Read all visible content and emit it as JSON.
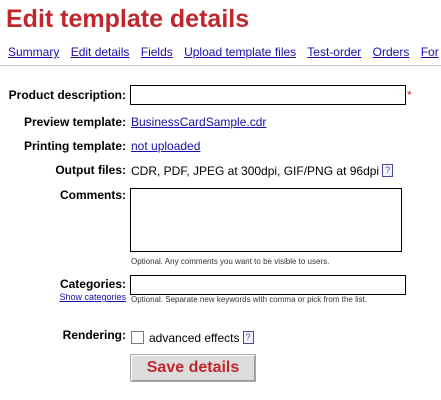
{
  "page": {
    "title": "Edit template details"
  },
  "nav": {
    "items": [
      {
        "label": "Summary"
      },
      {
        "label": "Edit details"
      },
      {
        "label": "Fields"
      },
      {
        "label": "Upload template files"
      },
      {
        "label": "Test-order"
      },
      {
        "label": "Orders"
      },
      {
        "label": "For"
      }
    ]
  },
  "form": {
    "product_description": {
      "label": "Product description:",
      "value": "",
      "required_mark": "*"
    },
    "preview_template": {
      "label": "Preview template:",
      "value": "BusinessCardSample.cdr"
    },
    "printing_template": {
      "label": "Printing template:",
      "value": "not uploaded"
    },
    "output_files": {
      "label": "Output files:",
      "value": "CDR, PDF, JPEG at 300dpi, GIF/PNG at 96dpi",
      "help": "?"
    },
    "comments": {
      "label": "Comments:",
      "value": "",
      "hint": "Optional. Any comments you want to be visible to users."
    },
    "categories": {
      "label": "Categories:",
      "value": "",
      "show_link": "Show categories",
      "hint": "Optional. Separate new keywords with comma or pick from the list."
    },
    "rendering": {
      "label": "Rendering:",
      "checkbox_label": "advanced effects",
      "checked": false,
      "help": "?"
    },
    "save_label": "Save details"
  },
  "colors": {
    "title": "#c0272d",
    "link": "#1a0dab",
    "required": "#e02020"
  }
}
